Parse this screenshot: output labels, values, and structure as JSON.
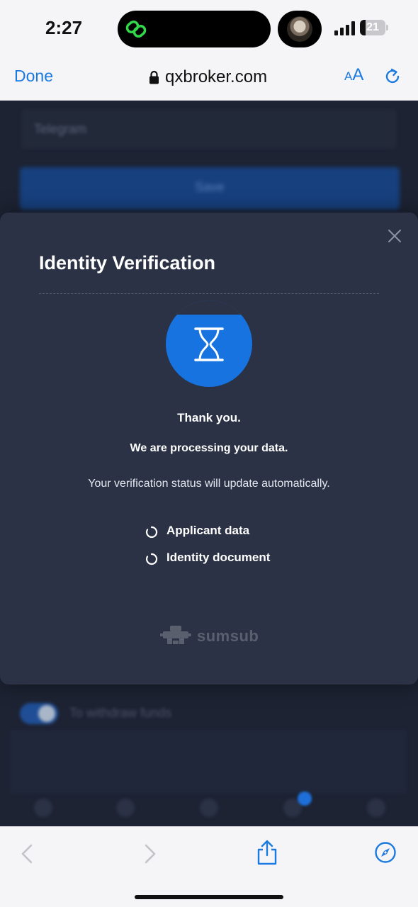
{
  "status_bar": {
    "time": "2:27",
    "battery_level": "21"
  },
  "browser": {
    "done_label": "Done",
    "url": "qxbroker.com",
    "text_size_label_small": "A",
    "text_size_label_big": "A"
  },
  "background_page": {
    "field_placeholder": "Telegram",
    "button_label": "Save",
    "toggle_label": "To withdraw funds"
  },
  "modal": {
    "title": "Identity Verification",
    "thanks": "Thank you.",
    "processing": "We are processing your data.",
    "status_message": "Your verification status will update automatically.",
    "checklist": [
      {
        "label": "Applicant data",
        "state": "pending"
      },
      {
        "label": "Identity document",
        "state": "pending"
      }
    ],
    "brand": "sumsub",
    "accent_color": "#1673e0"
  },
  "toolbar": {
    "back_enabled": false,
    "forward_enabled": false,
    "icons": [
      "chevron-left-icon",
      "chevron-right-icon",
      "share-icon",
      "compass-icon"
    ]
  }
}
